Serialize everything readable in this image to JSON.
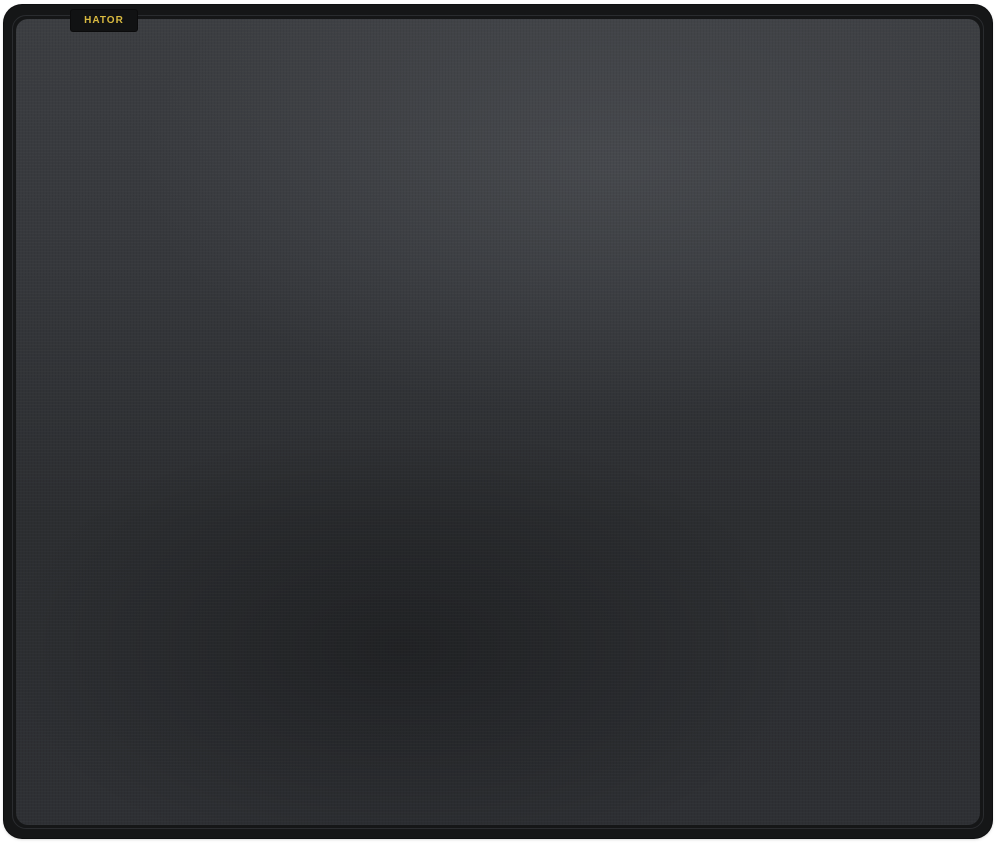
{
  "product": {
    "brand_label": "HATOR",
    "colors": {
      "brand_text": "#d8b940",
      "pad_surface": "#36383c",
      "pad_edge": "#151617",
      "tag_background": "#111213"
    }
  }
}
